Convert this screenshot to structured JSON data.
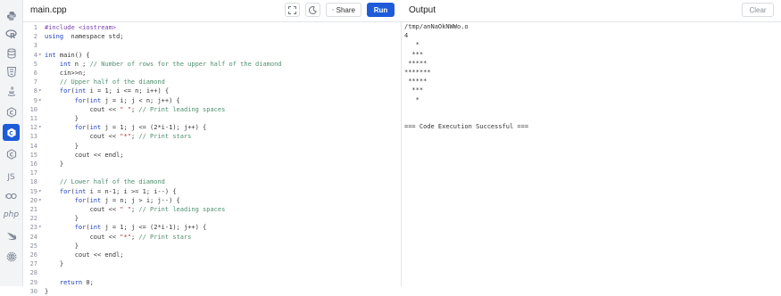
{
  "editor": {
    "file_tab": "main.cpp",
    "lines": [
      {
        "num": "1",
        "fold": false,
        "parts": [
          [
            "inc",
            "#include <iostream>"
          ]
        ]
      },
      {
        "num": "2",
        "fold": false,
        "parts": [
          [
            "kw",
            "using"
          ],
          [
            "",
            "  namespace std;"
          ]
        ]
      },
      {
        "num": "3",
        "fold": false,
        "parts": []
      },
      {
        "num": "4",
        "fold": true,
        "parts": [
          [
            "kw",
            "int"
          ],
          [
            "",
            " main() {"
          ]
        ]
      },
      {
        "num": "5",
        "fold": false,
        "parts": [
          [
            "",
            "    "
          ],
          [
            "kw",
            "int"
          ],
          [
            "",
            " n ; "
          ],
          [
            "cm",
            "// Number of rows for the upper half of the diamond"
          ]
        ]
      },
      {
        "num": "6",
        "fold": false,
        "parts": [
          [
            "",
            "    cin>>n;"
          ]
        ]
      },
      {
        "num": "7",
        "fold": false,
        "parts": [
          [
            "",
            "    "
          ],
          [
            "cm",
            "// Upper half of the diamond"
          ]
        ]
      },
      {
        "num": "8",
        "fold": true,
        "parts": [
          [
            "",
            "    "
          ],
          [
            "kw",
            "for"
          ],
          [
            "",
            "("
          ],
          [
            "kw",
            "int"
          ],
          [
            "",
            " i = 1; i <= n; i++) {"
          ]
        ]
      },
      {
        "num": "9",
        "fold": true,
        "parts": [
          [
            "",
            "        "
          ],
          [
            "kw",
            "for"
          ],
          [
            "",
            "("
          ],
          [
            "kw",
            "int"
          ],
          [
            "",
            " j = i; j < n; j++) {"
          ]
        ]
      },
      {
        "num": "10",
        "fold": false,
        "parts": [
          [
            "",
            "            cout << "
          ],
          [
            "str",
            "\" \""
          ],
          [
            "",
            "; "
          ],
          [
            "cm",
            "// Print leading spaces"
          ]
        ]
      },
      {
        "num": "11",
        "fold": false,
        "parts": [
          [
            "",
            "        }"
          ]
        ]
      },
      {
        "num": "12",
        "fold": true,
        "parts": [
          [
            "",
            "        "
          ],
          [
            "kw",
            "for"
          ],
          [
            "",
            "("
          ],
          [
            "kw",
            "int"
          ],
          [
            "",
            " j = 1; j <= (2*i-1); j++) {"
          ]
        ]
      },
      {
        "num": "13",
        "fold": false,
        "parts": [
          [
            "",
            "            cout << "
          ],
          [
            "str",
            "\"*\""
          ],
          [
            "",
            "; "
          ],
          [
            "cm",
            "// Print stars"
          ]
        ]
      },
      {
        "num": "14",
        "fold": false,
        "parts": [
          [
            "",
            "        }"
          ]
        ]
      },
      {
        "num": "15",
        "fold": false,
        "parts": [
          [
            "",
            "        cout << endl;"
          ]
        ]
      },
      {
        "num": "16",
        "fold": false,
        "parts": [
          [
            "",
            "    }"
          ]
        ]
      },
      {
        "num": "17",
        "fold": false,
        "parts": []
      },
      {
        "num": "18",
        "fold": false,
        "parts": [
          [
            "",
            "    "
          ],
          [
            "cm",
            "// Lower half of the diamond"
          ]
        ]
      },
      {
        "num": "19",
        "fold": true,
        "parts": [
          [
            "",
            "    "
          ],
          [
            "kw",
            "for"
          ],
          [
            "",
            "("
          ],
          [
            "kw",
            "int"
          ],
          [
            "",
            " i = n-1; i >= 1; i--) {"
          ]
        ]
      },
      {
        "num": "20",
        "fold": true,
        "parts": [
          [
            "",
            "        "
          ],
          [
            "kw",
            "for"
          ],
          [
            "",
            "("
          ],
          [
            "kw",
            "int"
          ],
          [
            "",
            " j = n; j > i; j--) {"
          ]
        ]
      },
      {
        "num": "21",
        "fold": false,
        "parts": [
          [
            "",
            "            cout << "
          ],
          [
            "str",
            "\" \""
          ],
          [
            "",
            "; "
          ],
          [
            "cm",
            "// Print leading spaces"
          ]
        ]
      },
      {
        "num": "22",
        "fold": false,
        "parts": [
          [
            "",
            "        }"
          ]
        ]
      },
      {
        "num": "23",
        "fold": true,
        "parts": [
          [
            "",
            "        "
          ],
          [
            "kw",
            "for"
          ],
          [
            "",
            "("
          ],
          [
            "kw",
            "int"
          ],
          [
            "",
            " j = 1; j <= (2*i-1); j++) {"
          ]
        ]
      },
      {
        "num": "24",
        "fold": false,
        "parts": [
          [
            "",
            "            cout << "
          ],
          [
            "str",
            "\"*\""
          ],
          [
            "",
            "; "
          ],
          [
            "cm",
            "// Print stars"
          ]
        ]
      },
      {
        "num": "25",
        "fold": false,
        "parts": [
          [
            "",
            "        }"
          ]
        ]
      },
      {
        "num": "26",
        "fold": false,
        "parts": [
          [
            "",
            "        cout << endl;"
          ]
        ]
      },
      {
        "num": "27",
        "fold": false,
        "parts": [
          [
            "",
            "    }"
          ]
        ]
      },
      {
        "num": "28",
        "fold": false,
        "parts": []
      },
      {
        "num": "29",
        "fold": false,
        "parts": [
          [
            "",
            "    "
          ],
          [
            "kw",
            "return"
          ],
          [
            "",
            " 0;"
          ]
        ]
      },
      {
        "num": "30",
        "fold": false,
        "parts": [
          [
            "",
            "}"
          ]
        ]
      }
    ]
  },
  "toolbar": {
    "share_label": "Share",
    "run_label": "Run",
    "expand_icon": "expand-icon",
    "theme_icon": "moon-icon",
    "share_icon": "share-icon"
  },
  "output": {
    "title": "Output",
    "clear_label": "Clear",
    "lines": [
      "/tmp/anNaOkNWWo.o",
      "4",
      "   *",
      "  ***",
      " *****",
      "*******",
      " *****",
      "  ***",
      "   *",
      "",
      "",
      "=== Code Execution Successful ==="
    ]
  },
  "sidebar": {
    "items": [
      {
        "icon": "python-icon",
        "label": ""
      },
      {
        "icon": "r-icon",
        "label": ""
      },
      {
        "icon": "sql-icon",
        "label": ""
      },
      {
        "icon": "html5-icon",
        "label": ""
      },
      {
        "icon": "java-icon",
        "label": ""
      },
      {
        "icon": "c-icon",
        "label": ""
      },
      {
        "icon": "cpp-icon",
        "label": ""
      },
      {
        "icon": "csharp-icon",
        "label": ""
      },
      {
        "icon": "javascript-icon",
        "label": "JS"
      },
      {
        "icon": "go-icon",
        "label": ""
      },
      {
        "icon": "php-icon",
        "label": "php"
      },
      {
        "icon": "swift-icon",
        "label": ""
      },
      {
        "icon": "rust-icon",
        "label": ""
      }
    ],
    "active_index": 6
  },
  "colors": {
    "accent": "#1d5bd8",
    "sidebar_bg": "#f3f4f6",
    "keyword": "#1d3fb8",
    "comment": "#4f8f6f"
  }
}
